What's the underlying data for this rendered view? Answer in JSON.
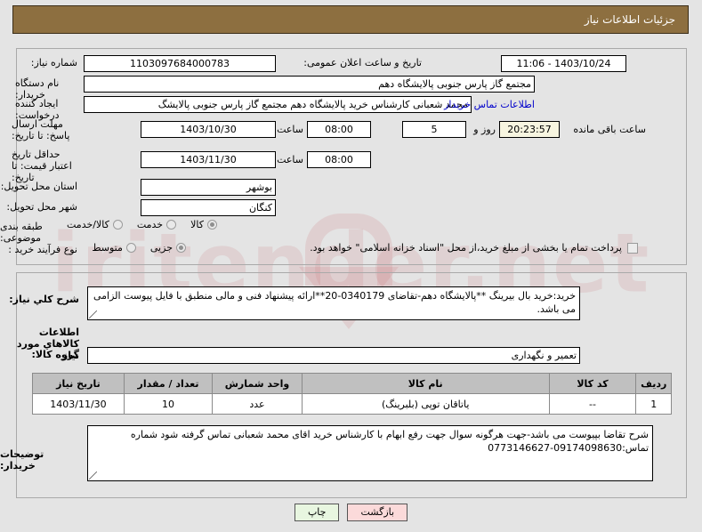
{
  "window": {
    "title": "جزئیات اطلاعات نیاز",
    "header_bg": "#8d6f40"
  },
  "watermark": {
    "text": "iritender.net"
  },
  "fields": {
    "need_number": {
      "label": "شماره نیاز:",
      "value": "1103097684000783"
    },
    "public_announce": {
      "label": "تاریخ و ساعت اعلان عمومی:",
      "value": "1403/10/24 - 11:06"
    },
    "buyer_org": {
      "label": "نام دستگاه خریدار:",
      "value": "مجتمع گاز پارس جنوبی  پالایشگاه دهم"
    },
    "requester": {
      "label": "ایجاد کننده درخواست:",
      "value": "محمد شعبانی کارشناس خرید پالایشگاه دهم  مجتمع گاز پارس جنوبی  پالایشگ",
      "link": "اطلاعات تماس خریدار"
    },
    "response_deadline": {
      "label": "مهلت ارسال پاسخ: تا تاریخ:",
      "date": "1403/10/30",
      "time_label": "ساعت",
      "time": "08:00",
      "days": "5",
      "days_label": "روز و",
      "countdown": "20:23:57",
      "countdown_label": "ساعت باقی مانده"
    },
    "price_validity": {
      "label": "حداقل تاریخ اعتبار قیمت: تا تاریخ:",
      "date": "1403/11/30",
      "time_label": "ساعت",
      "time": "08:00"
    },
    "province": {
      "label": "استان محل تحویل:",
      "value": "بوشهر"
    },
    "city": {
      "label": "شهر محل تحویل:",
      "value": "کنگان"
    },
    "subject_category": {
      "label": "طبقه بندی موضوعی:",
      "options": [
        "کالا",
        "خدمت",
        "کالا/خدمت"
      ],
      "selected": 0
    },
    "purchase_type": {
      "label": "نوع فرآیند خرید :",
      "options": [
        "جزیی",
        "متوسط"
      ],
      "selected": 0,
      "checkbox_label": "پرداخت تمام یا بخشی از مبلغ خرید،از محل \"اسناد خزانه اسلامی\" خواهد بود.",
      "checkbox_checked": false
    },
    "general_description": {
      "label": "شرح كلي نياز:",
      "value": "خرید:خرید بال بیرینگ **پالایشگاه دهم-تقاضای 0340179-20**ارائه پیشنهاد فنی و مالی منطبق با فایل پیوست الزامی می باشد."
    },
    "goods_info_heading": "اطلاعات كالاهاي مورد نياز",
    "goods_group": {
      "label": "گروه كالا:",
      "value": "تعمیر و نگهداری"
    },
    "buyer_notes": {
      "label": "توضیحات خریدار:",
      "value": "شرح تقاضا بپیوست می باشد-جهت هرگونه سوال جهت رفع ابهام با کارشناس خرید اقای محمد شعبانی تماس گرفته شود شماره تماس:09174098630-0773146627"
    }
  },
  "goods_table": {
    "headers": [
      "ردیف",
      "کد کالا",
      "نام کالا",
      "واحد شمارش",
      "تعداد / مقدار",
      "تاریخ نیاز"
    ],
    "rows": [
      {
        "row_no": "1",
        "code": "--",
        "name": "یاتاقان توپی (بلبرینگ)",
        "unit": "عدد",
        "qty": "10",
        "need_date": "1403/11/30"
      }
    ]
  },
  "footer": {
    "print_label": "چاپ",
    "back_label": "بازگشت"
  }
}
